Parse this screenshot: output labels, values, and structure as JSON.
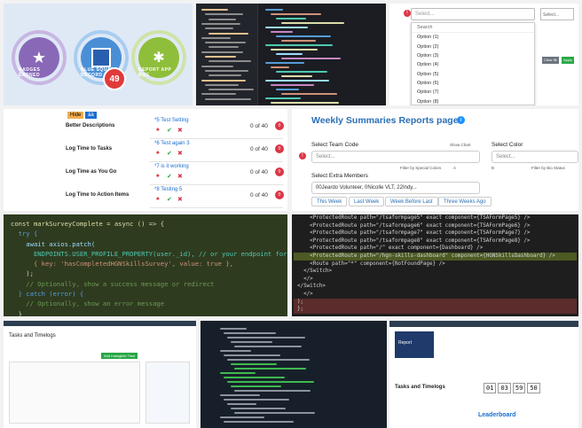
{
  "badges": {
    "items": [
      {
        "text": "BADGES EARNED",
        "color": "#8a68b8",
        "icon": "star-icon"
      },
      {
        "text": "BLUE SQUARE RECORD",
        "color": "#4a8fd6",
        "icon": "square-icon"
      },
      {
        "text": "REPORT APP BUG",
        "color": "#8fbf3a",
        "icon": "bug-icon"
      }
    ],
    "count": "49",
    "count_color": "#e03a3a"
  },
  "dropdown": {
    "placeholder": "Select...",
    "search": "Search",
    "items": [
      "Option (1)",
      "Option (2)",
      "Option (3)",
      "Option (4)",
      "Option (5)",
      "Option (6)",
      "Option (7)",
      "Option (8)"
    ],
    "right_placeholder": "Select...",
    "btn_a": "Clear filt",
    "btn_b": "Apply"
  },
  "tasks": {
    "tag_a": "Hide",
    "tag_b": "áà",
    "rows": [
      {
        "label": "Better Descriptions",
        "link": "*5 Test Setting",
        "count": "0 of 40",
        "badge": "0"
      },
      {
        "label": "Log Time to Tasks",
        "link": "*6 Test again 3",
        "count": "0 of 40",
        "badge": "0"
      },
      {
        "label": "Log Time as You Go",
        "link": "*7 is it working",
        "count": "0 of 40",
        "badge": "0"
      },
      {
        "label": "Log Time to Action Items",
        "link": "*8 Testing 5",
        "count": "0 of 40",
        "badge": "0"
      }
    ]
  },
  "weekly": {
    "title": "Weekly Summaries Reports page",
    "team_code_label": "Select Team Code",
    "color_label": "Select Color",
    "placeholder": "Select...",
    "show_chart": "Show Chart",
    "filter_special": "Filter by Special Colors",
    "options_a": "A",
    "options_b": "B",
    "filter_bio": "Filter by Bio Status",
    "extra_members_label": "Select Extra Members",
    "members_value": "00Jeardo Volunteer, 0Nicolle VLT, 22Indy...",
    "buttons": [
      "This Week",
      "Last Week",
      "Week Before Last",
      "Three Weeks Ago"
    ]
  },
  "code": {
    "lines": [
      "const markSurveyComplete = async () => {",
      "  try {",
      "    await axios.patch(",
      "      ENDPOINTS.USER_PROFILE_PROPERTY(user._id), // or your endpoint for",
      "      { key: 'hasCompletedHGNSkillsSurvey', value: true },",
      "    );",
      "    // Optionally, show a success message or redirect",
      "  } catch (error) {",
      "    // Optionally, show an error message",
      "  }"
    ]
  },
  "jsx": {
    "lines": [
      "    <ProtectedRoute path=\"/tsaformpage5\" exact component={TSAFormPage5} />",
      "    <ProtectedRoute path=\"/tsaformpage6\" exact component={TSAFormPage6} />",
      "    <ProtectedRoute path=\"/tsaformpage7\" exact component={TSAFormPage7} />",
      "    <ProtectedRoute path=\"/tsaformpage8\" exact component={TSAFormPage8} />",
      "    <ProtectedRoute path=\"/\" exact component={Dashboard} />",
      "    <ProtectedRoute path=\"/hgn-skills-dashboard\" component={HGNSkillsDashboard} />",
      "    <Route path=\"*\" component={NotFoundPage} />",
      "  </Switch>",
      "  </>",
      "</Switch>",
      "  </>",
      ");",
      "};"
    ]
  },
  "bottom": {
    "b1_title": "Tasks and Timelogs",
    "b1_button": "Add Intangible Time",
    "b3_title": "Tasks and Timelogs",
    "b3_leader": "Leaderboard",
    "b3_timer": [
      "01",
      "03",
      "59",
      "50"
    ],
    "b3_report": "Report"
  }
}
